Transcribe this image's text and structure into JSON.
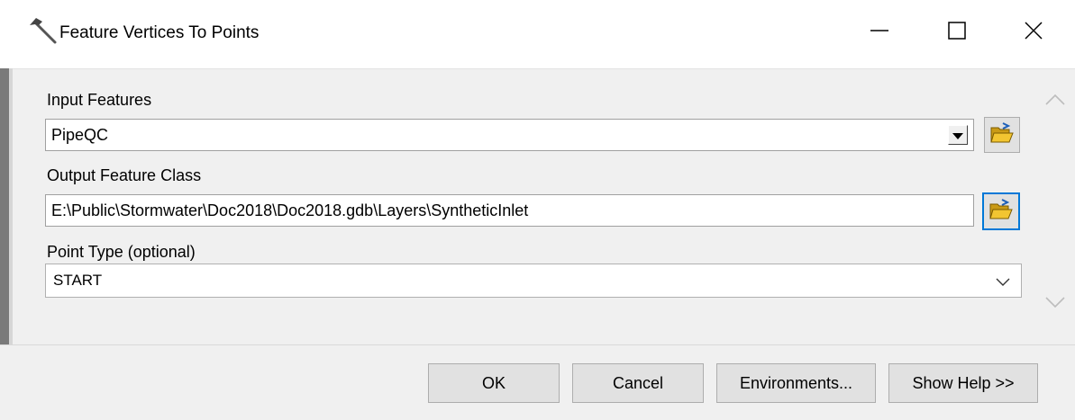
{
  "window": {
    "title": "Feature Vertices To Points",
    "icon": "hammer-icon",
    "controls": [
      "minimize-icon",
      "maximize-icon",
      "close-icon"
    ]
  },
  "form": {
    "input_features": {
      "label": "Input Features",
      "value": "PipeQC",
      "browse_icon": "open-folder-icon"
    },
    "output_feature_class": {
      "label": "Output Feature Class",
      "value": "E:\\Public\\Stormwater\\Doc2018\\Doc2018.gdb\\Layers\\SyntheticInlet",
      "browse_icon": "open-folder-icon"
    },
    "point_type": {
      "label": "Point Type (optional)",
      "value": "START"
    }
  },
  "buttons": {
    "ok": "OK",
    "cancel": "Cancel",
    "environments": "Environments...",
    "show_help": "Show Help >>"
  },
  "colors": {
    "focus": "#0078d7",
    "folder": "#e8b923"
  }
}
